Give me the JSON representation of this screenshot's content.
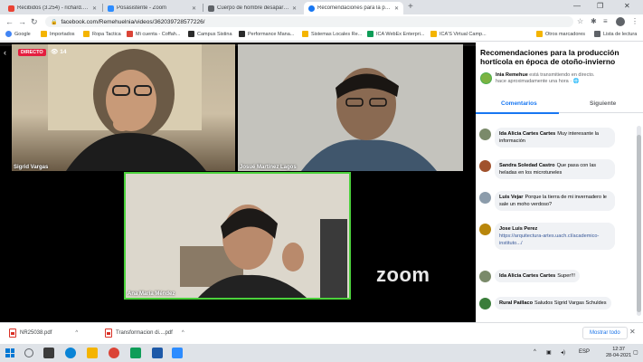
{
  "tabs": [
    {
      "title": "Recibidos (3.254) - richard.gallar",
      "fav_color": "#ea4335",
      "active": false
    },
    {
      "title": "Posasistente - Zoom",
      "fav_color": "#2d8cff",
      "active": false
    },
    {
      "title": "Cuerpo de hombre desaparecido",
      "fav_color": "#5f6368",
      "active": false
    },
    {
      "title": "Recomendaciones para la produc",
      "fav_color": "#1877f2",
      "active": true
    }
  ],
  "address": {
    "url": "facebook.com/Remehuelnia/videos/362039728577226/"
  },
  "bookmarks": [
    {
      "label": "Google",
      "color": "#4285f4"
    },
    {
      "label": "Importados",
      "color": "#f4b400"
    },
    {
      "label": "Ropa Tactica",
      "color": "#f4b400"
    },
    {
      "label": "Mi cuenta - Coffah...",
      "color": "#db4437"
    },
    {
      "label": "Campus Sistina",
      "color": "#2b2b2b"
    },
    {
      "label": "Performance Mana...",
      "color": "#2b2b2b"
    },
    {
      "label": "Sistemas Locales Re...",
      "color": "#f4b400"
    },
    {
      "label": "ICA WebEx Enterpri...",
      "color": "#0f9d58"
    },
    {
      "label": "ICA'S Virtual Camp...",
      "color": "#f4b400"
    },
    {
      "label": "Otros marcadores",
      "color": "#f4b400"
    },
    {
      "label": "Lista de lectura",
      "color": "#5f6368"
    }
  ],
  "video": {
    "live_label": "DIRECTO",
    "viewer_count": "14",
    "participants": [
      {
        "name": "Sigrid Vargas"
      },
      {
        "name": "Josué Martínez Lagos"
      },
      {
        "name": "Ana María Méndez"
      }
    ],
    "zoom_label": "zoom"
  },
  "sidebar": {
    "title": "Recomendaciones para la producción hortícola en época de otoño-invierno",
    "page_name": "Inia Remehue",
    "live_status": " está transmitiendo en directo.",
    "time_ago": "hace aproximadamente una hora · 🌐",
    "tab_comments": "Comentarios",
    "tab_next": "Siguiente",
    "comments": [
      {
        "author": "Ida Alicia Cartes Cartes",
        "text": "Muy interesante la información",
        "avatar_color": "#7a8a6a"
      },
      {
        "author": "Sandra Soledad Castro",
        "text": "Que pasa con las heladas en los microtuneles",
        "avatar_color": "#a0522d"
      },
      {
        "author": "Luis Vejar",
        "text": "Porque la tierra de mi invernadero le sale un moho verdoso?",
        "avatar_color": "#8c9cab"
      },
      {
        "author": "Jose Luis Perez",
        "text": "",
        "link": "https://arquitectura-artes.uach.cl/academico-instituto.../",
        "avatar_color": "#b8860b"
      },
      {
        "author": "Ida Alicia Cartes Cartes",
        "text": "Super!!!",
        "avatar_color": "#7a8a6a"
      },
      {
        "author": "Rural Paillaco",
        "text": "Saludos Sigrid Vargas Schuldes",
        "avatar_color": "#3a7d3a"
      }
    ]
  },
  "downloads": [
    {
      "name": "NR25038.pdf"
    },
    {
      "name": "Transformacion di....pdf"
    }
  ],
  "show_all": "Mostrar todo",
  "taskbar": {
    "lang": "ESP",
    "time": "12:37",
    "date": "28-04-2021"
  }
}
